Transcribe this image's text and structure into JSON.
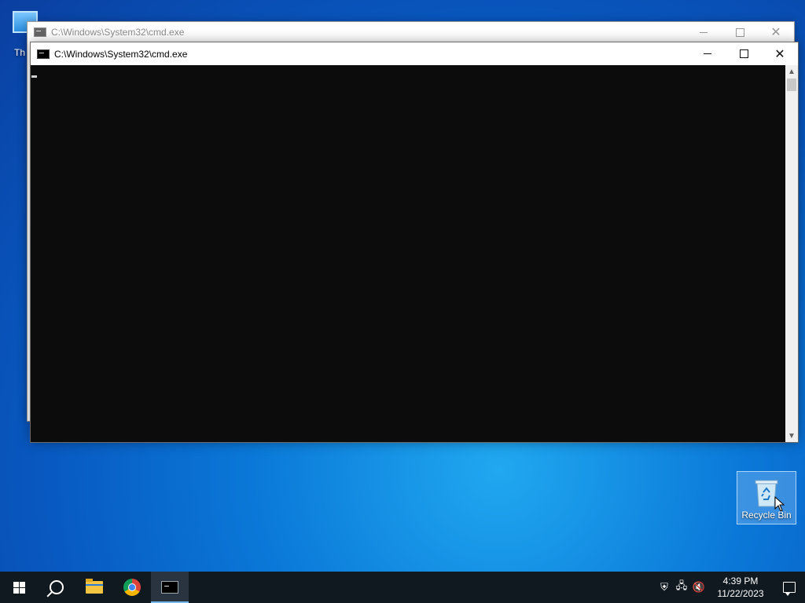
{
  "desktop": {
    "this_pc_label_visible": "Th",
    "recycle_bin_label": "Recycle Bin"
  },
  "back_window": {
    "title": "C:\\Windows\\System32\\cmd.exe",
    "icon": "cmd-icon"
  },
  "front_window": {
    "title": "C:\\Windows\\System32\\cmd.exe",
    "icon": "cmd-icon",
    "console_bg": "#0c0c0c"
  },
  "caption_buttons": {
    "minimize": "minimize-icon",
    "maximize": "maximize-icon",
    "close": "close-icon",
    "close_glyph": "✕"
  },
  "scrollbar": {
    "up_glyph": "▲",
    "down_glyph": "▼"
  },
  "taskbar": {
    "start": "windows-logo-icon",
    "search": "search-icon",
    "apps": [
      "file-explorer-icon",
      "chrome-icon",
      "cmd-icon"
    ],
    "active_app": "cmd-icon",
    "tray": {
      "security_glyph": "⛨",
      "network_glyph": "🖧",
      "volume_glyph": "🔇",
      "time": "4:39 PM",
      "date": "11/22/2023"
    }
  },
  "colors": {
    "taskbar_bg": "#101820",
    "accent": "#76b9ed"
  }
}
